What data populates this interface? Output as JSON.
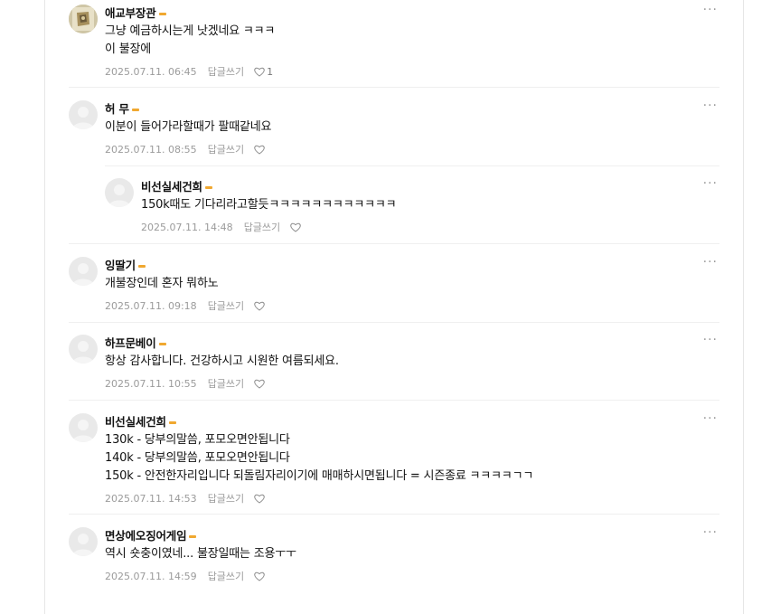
{
  "comments": [
    {
      "nick": "애교부장관",
      "lines": [
        "그냥 예금하시는게 낫겠네요 ㅋㅋㅋ",
        "이 불장에"
      ],
      "date": "2025.07.11. 06:45",
      "reply_label": "답글쓰기",
      "likes": "1",
      "avatar": "photo"
    },
    {
      "nick": "허 무",
      "lines": [
        "이분이 들어가라할때가 팔때같네요"
      ],
      "date": "2025.07.11. 08:55",
      "reply_label": "답글쓰기",
      "likes": "",
      "avatar": "default"
    },
    {
      "nick": "비선실세건희",
      "lines": [
        "150k때도 기다리라고할듯ㅋㅋㅋㅋㅋㅋㅋㅋㅋㅋㅋㅋ"
      ],
      "date": "2025.07.11. 14:48",
      "reply_label": "답글쓰기",
      "likes": "",
      "avatar": "default"
    },
    {
      "nick": "잉딸기",
      "lines": [
        "개불장인데 혼자 뭐하노"
      ],
      "date": "2025.07.11. 09:18",
      "reply_label": "답글쓰기",
      "likes": "",
      "avatar": "default"
    },
    {
      "nick": "하프문베이",
      "lines": [
        "항상 감사합니다. 건강하시고 시원한 여름되세요."
      ],
      "date": "2025.07.11. 10:55",
      "reply_label": "답글쓰기",
      "likes": "",
      "avatar": "default"
    },
    {
      "nick": "비선실세건희",
      "lines": [
        "130k - 당부의말씀, 포모오면안됩니다",
        "140k - 당부의말씀, 포모오면안됩니다",
        "150k - 안전한자리입니다 되돌림자리이기에 매매하시면됩니다 = 시즌종료 ㅋㅋㅋㅋㄱㄱ"
      ],
      "date": "2025.07.11. 14:53",
      "reply_label": "답글쓰기",
      "likes": "",
      "avatar": "default"
    },
    {
      "nick": "면상에오징어게임",
      "lines": [
        "역시 숏충이였네... 불장일때는 조용ㅜㅜ"
      ],
      "date": "2025.07.11. 14:59",
      "reply_label": "답글쓰기",
      "likes": "",
      "avatar": "default"
    }
  ],
  "icons": {
    "more": "more-dots-icon",
    "like": "heart-outline-icon",
    "badge": "level-badge-icon",
    "avatar": "default-avatar-icon"
  },
  "colors": {
    "badge": "#f0a830",
    "meta": "#9b9b9b",
    "separator": "#efefef"
  }
}
